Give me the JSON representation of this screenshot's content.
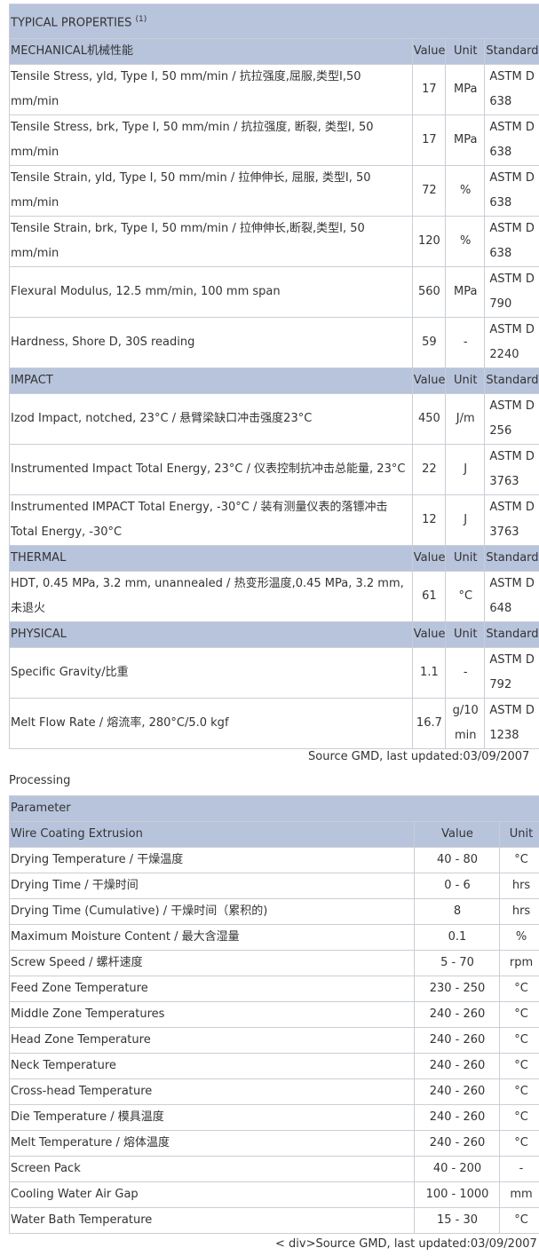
{
  "props_title": "TYPICAL PROPERTIES",
  "props_title_sup": "(1)",
  "col_value": "Value",
  "col_unit": "Unit",
  "col_standard": "Standard",
  "sections": [
    {
      "name": "MECHANICAL机械性能",
      "rows": [
        {
          "prop": "Tensile Stress, yld, Type I, 50 mm/min / 抗拉强度,屈服,类型I,50 mm/min",
          "value": "17",
          "unit": "MPa",
          "std": "ASTM D 638"
        },
        {
          "prop": "Tensile Stress, brk, Type I, 50 mm/min / 抗拉强度, 断裂, 类型I, 50 mm/min",
          "value": "17",
          "unit": "MPa",
          "std": "ASTM D 638"
        },
        {
          "prop": "Tensile Strain, yld, Type I, 50 mm/min / 拉伸伸长, 屈服, 类型I, 50 mm/min",
          "value": "72",
          "unit": "%",
          "std": "ASTM D 638"
        },
        {
          "prop": "Tensile Strain, brk, Type I, 50 mm/min / 拉伸伸长,断裂,类型I, 50 mm/min",
          "value": "120",
          "unit": "%",
          "std": "ASTM D 638"
        },
        {
          "prop": "Flexural Modulus, 12.5 mm/min, 100 mm span",
          "value": "560",
          "unit": "MPa",
          "std": "ASTM D 790"
        },
        {
          "prop": "Hardness, Shore D, 30S reading",
          "value": "59",
          "unit": "-",
          "std": "ASTM D 2240"
        }
      ]
    },
    {
      "name": "IMPACT",
      "rows": [
        {
          "prop": "Izod Impact, notched, 23°C / 悬臂梁缺口冲击强度23°C",
          "value": "450",
          "unit": "J/m",
          "std": "ASTM D 256"
        },
        {
          "prop": "Instrumented Impact Total Energy, 23°C / 仪表控制抗冲击总能量, 23°C",
          "value": "22",
          "unit": "J",
          "std": "ASTM D 3763"
        },
        {
          "prop": "Instrumented IMPACT Total Energy, -30°C / 装有测量仪表的落镖冲击Total Energy, -30°C",
          "value": "12",
          "unit": "J",
          "std": "ASTM D 3763"
        }
      ]
    },
    {
      "name": "THERMAL",
      "rows": [
        {
          "prop": "HDT, 0.45 MPa, 3.2 mm, unannealed / 热变形温度,0.45 MPa, 3.2 mm,未退火",
          "value": "61",
          "unit": "°C",
          "std": "ASTM D 648"
        }
      ]
    },
    {
      "name": "PHYSICAL",
      "rows": [
        {
          "prop": "Specific Gravity/比重",
          "value": "1.1",
          "unit": "-",
          "std": "ASTM D 792"
        },
        {
          "prop": "Melt Flow Rate / 熔流率, 280°C/5.0 kgf",
          "value": "16.7",
          "unit": "g/10 min",
          "std": "ASTM D 1238"
        }
      ]
    }
  ],
  "source1": "Source GMD, last updated:03/09/2007",
  "processing_title": "Processing",
  "proc_param_header": "Parameter",
  "proc_group": "Wire Coating Extrusion",
  "proc_col_value": "Value",
  "proc_col_unit": "Unit",
  "proc_rows": [
    {
      "param": "Drying Temperature / 干燥温度",
      "value": "40 - 80",
      "unit": "°C"
    },
    {
      "param": "Drying Time / 干燥时间",
      "value": "0 - 6",
      "unit": "hrs"
    },
    {
      "param": "Drying Time (Cumulative) / 干燥时间（累积的)",
      "value": "8",
      "unit": "hrs"
    },
    {
      "param": "Maximum Moisture Content / 最大含湿量",
      "value": "0.1",
      "unit": "%"
    },
    {
      "param": "Screw Speed / 螺杆速度",
      "value": "5 - 70",
      "unit": "rpm"
    },
    {
      "param": "Feed Zone Temperature",
      "value": "230 - 250",
      "unit": "°C"
    },
    {
      "param": "Middle Zone Temperatures",
      "value": "240 - 260",
      "unit": "°C"
    },
    {
      "param": "Head Zone Temperature",
      "value": "240 - 260",
      "unit": "°C"
    },
    {
      "param": "Neck Temperature",
      "value": "240 - 260",
      "unit": "°C"
    },
    {
      "param": "Cross-head Temperature",
      "value": "240 - 260",
      "unit": "°C"
    },
    {
      "param": "Die Temperature / 模具温度",
      "value": "240 - 260",
      "unit": "°C"
    },
    {
      "param": "Melt Temperature / 熔体温度",
      "value": "240 - 260",
      "unit": "°C"
    },
    {
      "param": "Screen Pack",
      "value": "40 - 200",
      "unit": "-"
    },
    {
      "param": "Cooling Water Air Gap",
      "value": "100 - 1000",
      "unit": "mm"
    },
    {
      "param": "Water Bath Temperature",
      "value": "15 - 30",
      "unit": "°C"
    }
  ],
  "source2": "< div>Source GMD, last updated:03/09/2007"
}
